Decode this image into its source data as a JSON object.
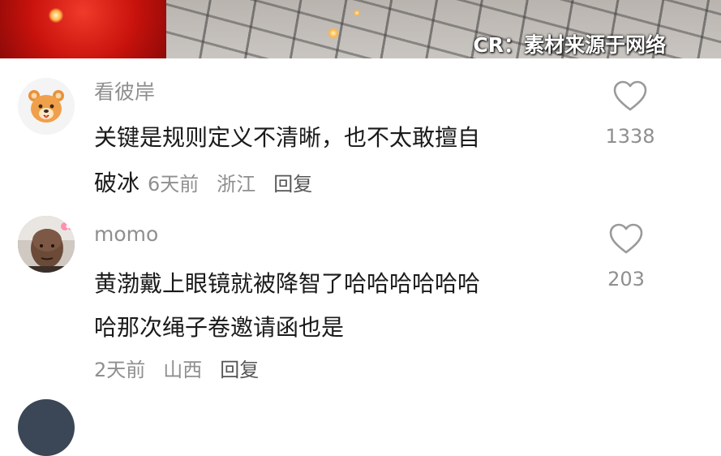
{
  "video": {
    "credit_text": "CR：素材来源于网络"
  },
  "comments": [
    {
      "username": "看彼岸",
      "text_line1": "关键是规则定义不清晰，也不太敢擅自",
      "text_line2": "破冰",
      "time": "6天前",
      "location": "浙江",
      "reply_label": "回复",
      "likes": "1338",
      "avatar_icon": "bear-avatar-icon"
    },
    {
      "username": "momo",
      "text_line1": "黄渤戴上眼镜就被降智了哈哈哈哈哈哈",
      "text_line2": "哈那次绳子卷邀请函也是",
      "time": "2天前",
      "location": "山西",
      "reply_label": "回复",
      "likes": "203",
      "avatar_icon": "person-photo-avatar-icon"
    }
  ],
  "colors": {
    "meta_gray": "#8f8f8f",
    "text_dark": "#1a1a1a",
    "bear_orange": "#f0a04a"
  }
}
